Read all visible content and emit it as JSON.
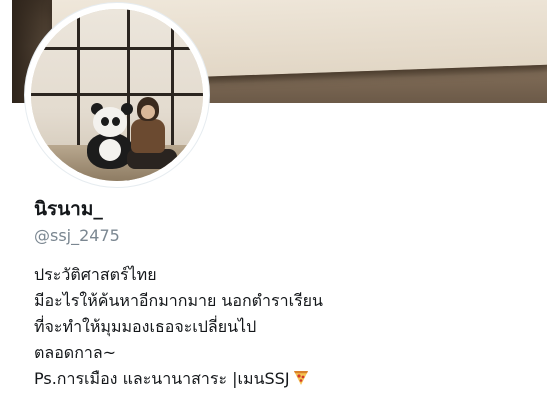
{
  "profile": {
    "display_name": "นิรนาม_",
    "handle": "@ssj_2475",
    "bio_lines": [
      "ประวัติศาสตร์ไทย",
      "มีอะไรให้ค้นหาอีกมากมาย นอกตำราเรียน",
      "ที่จะทำให้มุมมองเธอจะเปลี่ยนไป",
      "ตลอดกาล~",
      "Ps.การเมือง และนานาสาระ |เมนSSJ"
    ],
    "bio_end_icon": "pizza-icon"
  },
  "colors": {
    "text_primary": "#14171a",
    "text_secondary": "#7b8791",
    "background": "#ffffff"
  }
}
